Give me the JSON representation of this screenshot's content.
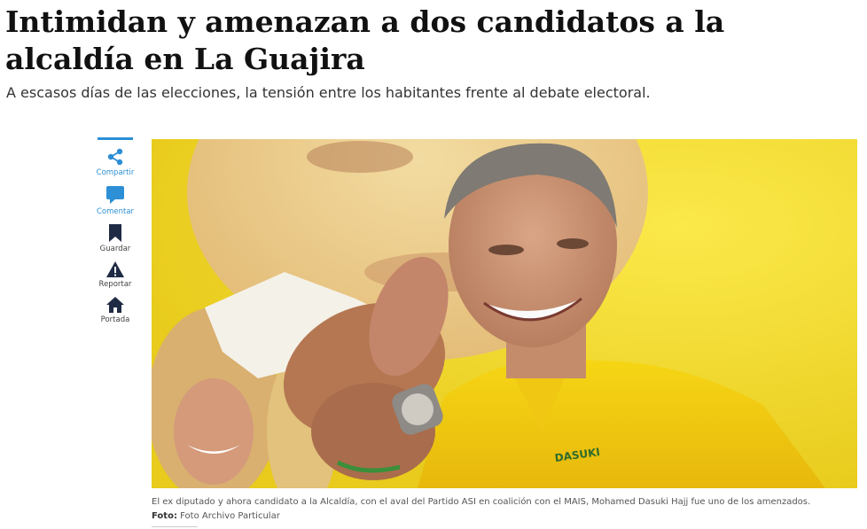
{
  "article": {
    "headline": "Intimidan y amenazan a dos candidatos a la alcaldía en La Guajira",
    "subtitle": "A escasos días de las elecciones, la tensión entre los habitantes frente al debate electoral."
  },
  "share_bar": {
    "items": [
      {
        "label": "Compartir",
        "icon": "share-icon",
        "color": "#2d8fd5"
      },
      {
        "label": "Comentar",
        "icon": "comment-icon",
        "color": "#2d8fd5"
      },
      {
        "label": "Guardar",
        "icon": "bookmark-icon",
        "color": "#1f2a44"
      },
      {
        "label": "Reportar",
        "icon": "warning-icon",
        "color": "#1f2a44"
      },
      {
        "label": "Portada",
        "icon": "home-icon",
        "color": "#1f2a44"
      }
    ]
  },
  "photo": {
    "shirt_text": "DASUKI"
  },
  "caption": {
    "text": "El ex diputado y ahora candidato a la Alcaldía, con el aval del Partido ASI en coalición con el MAIS, Mohamed Dasuki Hajj fue uno de los amenzados.",
    "credit_label": "Foto:",
    "credit_value": "Foto Archivo Particular"
  }
}
